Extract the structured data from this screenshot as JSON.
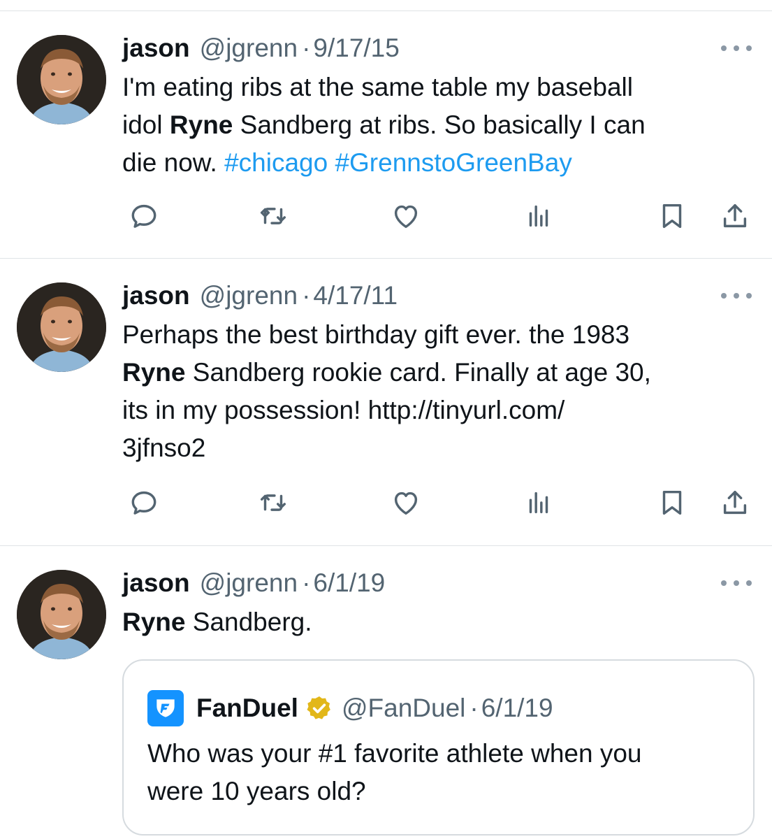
{
  "tweets": [
    {
      "name": "jason",
      "handle": "@jgrenn",
      "separator": "·",
      "date": "9/17/15",
      "text": {
        "line1": "I'm eating ribs at the same table my baseball",
        "line2_pre": "idol ",
        "line2_bold": "Ryne",
        "line2_post": " Sandberg at ribs. So basically I can",
        "line3_pre": "die now. ",
        "hashtag1": "#chicago",
        "hashtag2": "#GrennstoGreenBay"
      }
    },
    {
      "name": "jason",
      "handle": "@jgrenn",
      "separator": "·",
      "date": "4/17/11",
      "text": {
        "line1": "Perhaps the best birthday gift ever. the 1983",
        "line2_bold": "Ryne",
        "line2_post": " Sandberg rookie card. Finally at age 30,",
        "line3": "its in my possession! http://tinyurl.com/",
        "line4": "3jfnso2"
      }
    },
    {
      "name": "jason",
      "handle": "@jgrenn",
      "separator": "·",
      "date": "6/1/19",
      "text": {
        "line1_bold": "Ryne",
        "line1_post": " Sandberg."
      },
      "quote": {
        "name": "FanDuel",
        "handle": "@FanDuel",
        "separator": "·",
        "date": "6/1/19",
        "line1": "Who was your #1 favorite athlete when you",
        "line2": "were 10 years old?"
      }
    }
  ],
  "icons": [
    "reply-icon",
    "retweet-icon",
    "like-icon",
    "views-icon",
    "bookmark-icon",
    "share-icon",
    "more-icon",
    "verified-icon",
    "fanduel-logo"
  ],
  "colors": {
    "text": "#0f1419",
    "secondary": "#536471",
    "hashtag": "#1d9bf0",
    "divider": "#dfe3e6",
    "verified_gold": "#e2b719",
    "fanduel_blue": "#1493ff"
  }
}
